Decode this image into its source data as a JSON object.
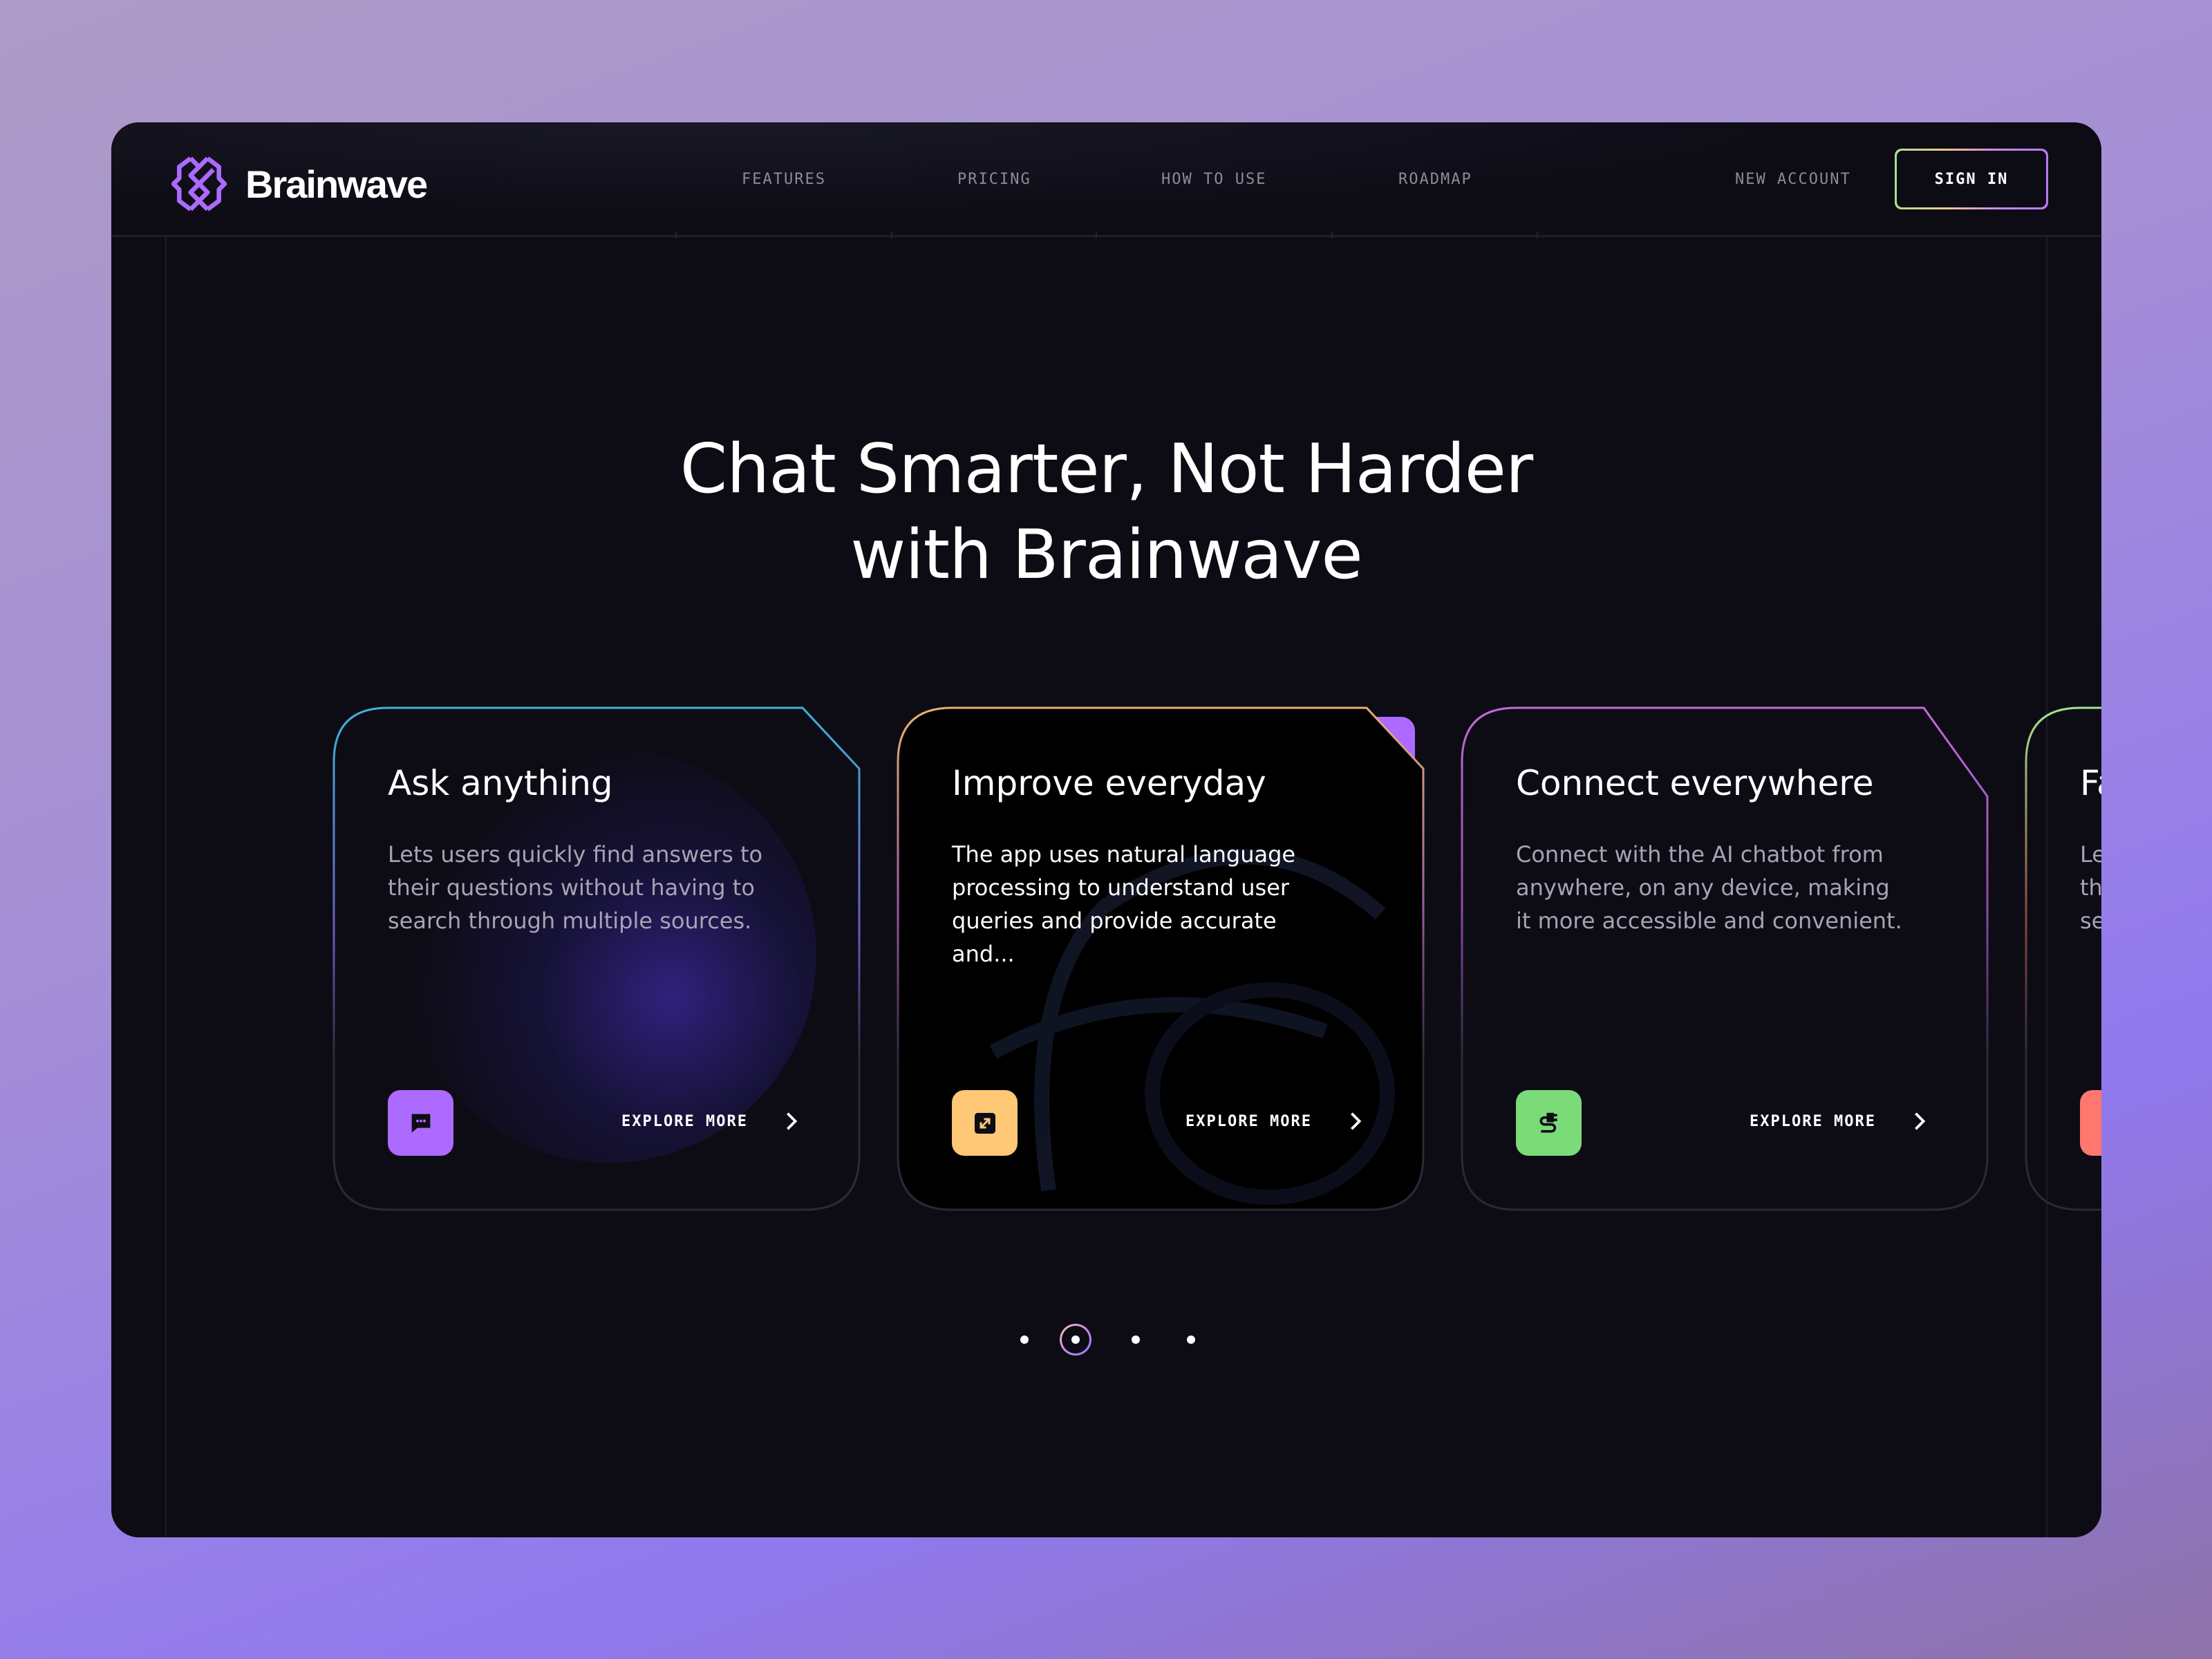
{
  "brand": {
    "name": "Brainwave",
    "color": "#ac6aff"
  },
  "nav": {
    "items": [
      "FEATURES",
      "PRICING",
      "HOW TO USE",
      "ROADMAP"
    ],
    "new_account": "NEW ACCOUNT",
    "sign_in": "SIGN IN"
  },
  "hero": {
    "line1": "Chat Smarter, Not Harder",
    "line2": "with Brainwave"
  },
  "cards": [
    {
      "title": "Ask anything",
      "description": "Lets users quickly find answers to their questions without having to search through multiple sources.",
      "icon": "chat-bubble-icon",
      "icon_color": "#ac6aff",
      "border": [
        "#3fb3d9",
        "#8a6af0"
      ],
      "cta": "EXPLORE MORE"
    },
    {
      "title": "Improve everyday",
      "description": "The app uses natural language processing to understand user queries and provide accurate and...",
      "icon": "expand-icon",
      "icon_color": "#ffc876",
      "border": [
        "#f3c88a",
        "#a36ac0"
      ],
      "cta": "EXPLORE MORE"
    },
    {
      "title": "Connect everywhere",
      "description": "Connect with the AI chatbot from anywhere, on any device, making it more accessible and convenient.",
      "icon": "plug-icon",
      "icon_color": "#7adb78",
      "border": [
        "#c46ad9",
        "#8a5ac0"
      ],
      "cta": "EXPLORE MORE"
    },
    {
      "title": "Fa",
      "description_lines": [
        "Le",
        "th",
        "se"
      ],
      "icon_color": "#ff776f",
      "border": [
        "#a5e38e",
        "#c46a5a"
      ]
    }
  ],
  "carousel": {
    "count": 4,
    "active": 1
  }
}
